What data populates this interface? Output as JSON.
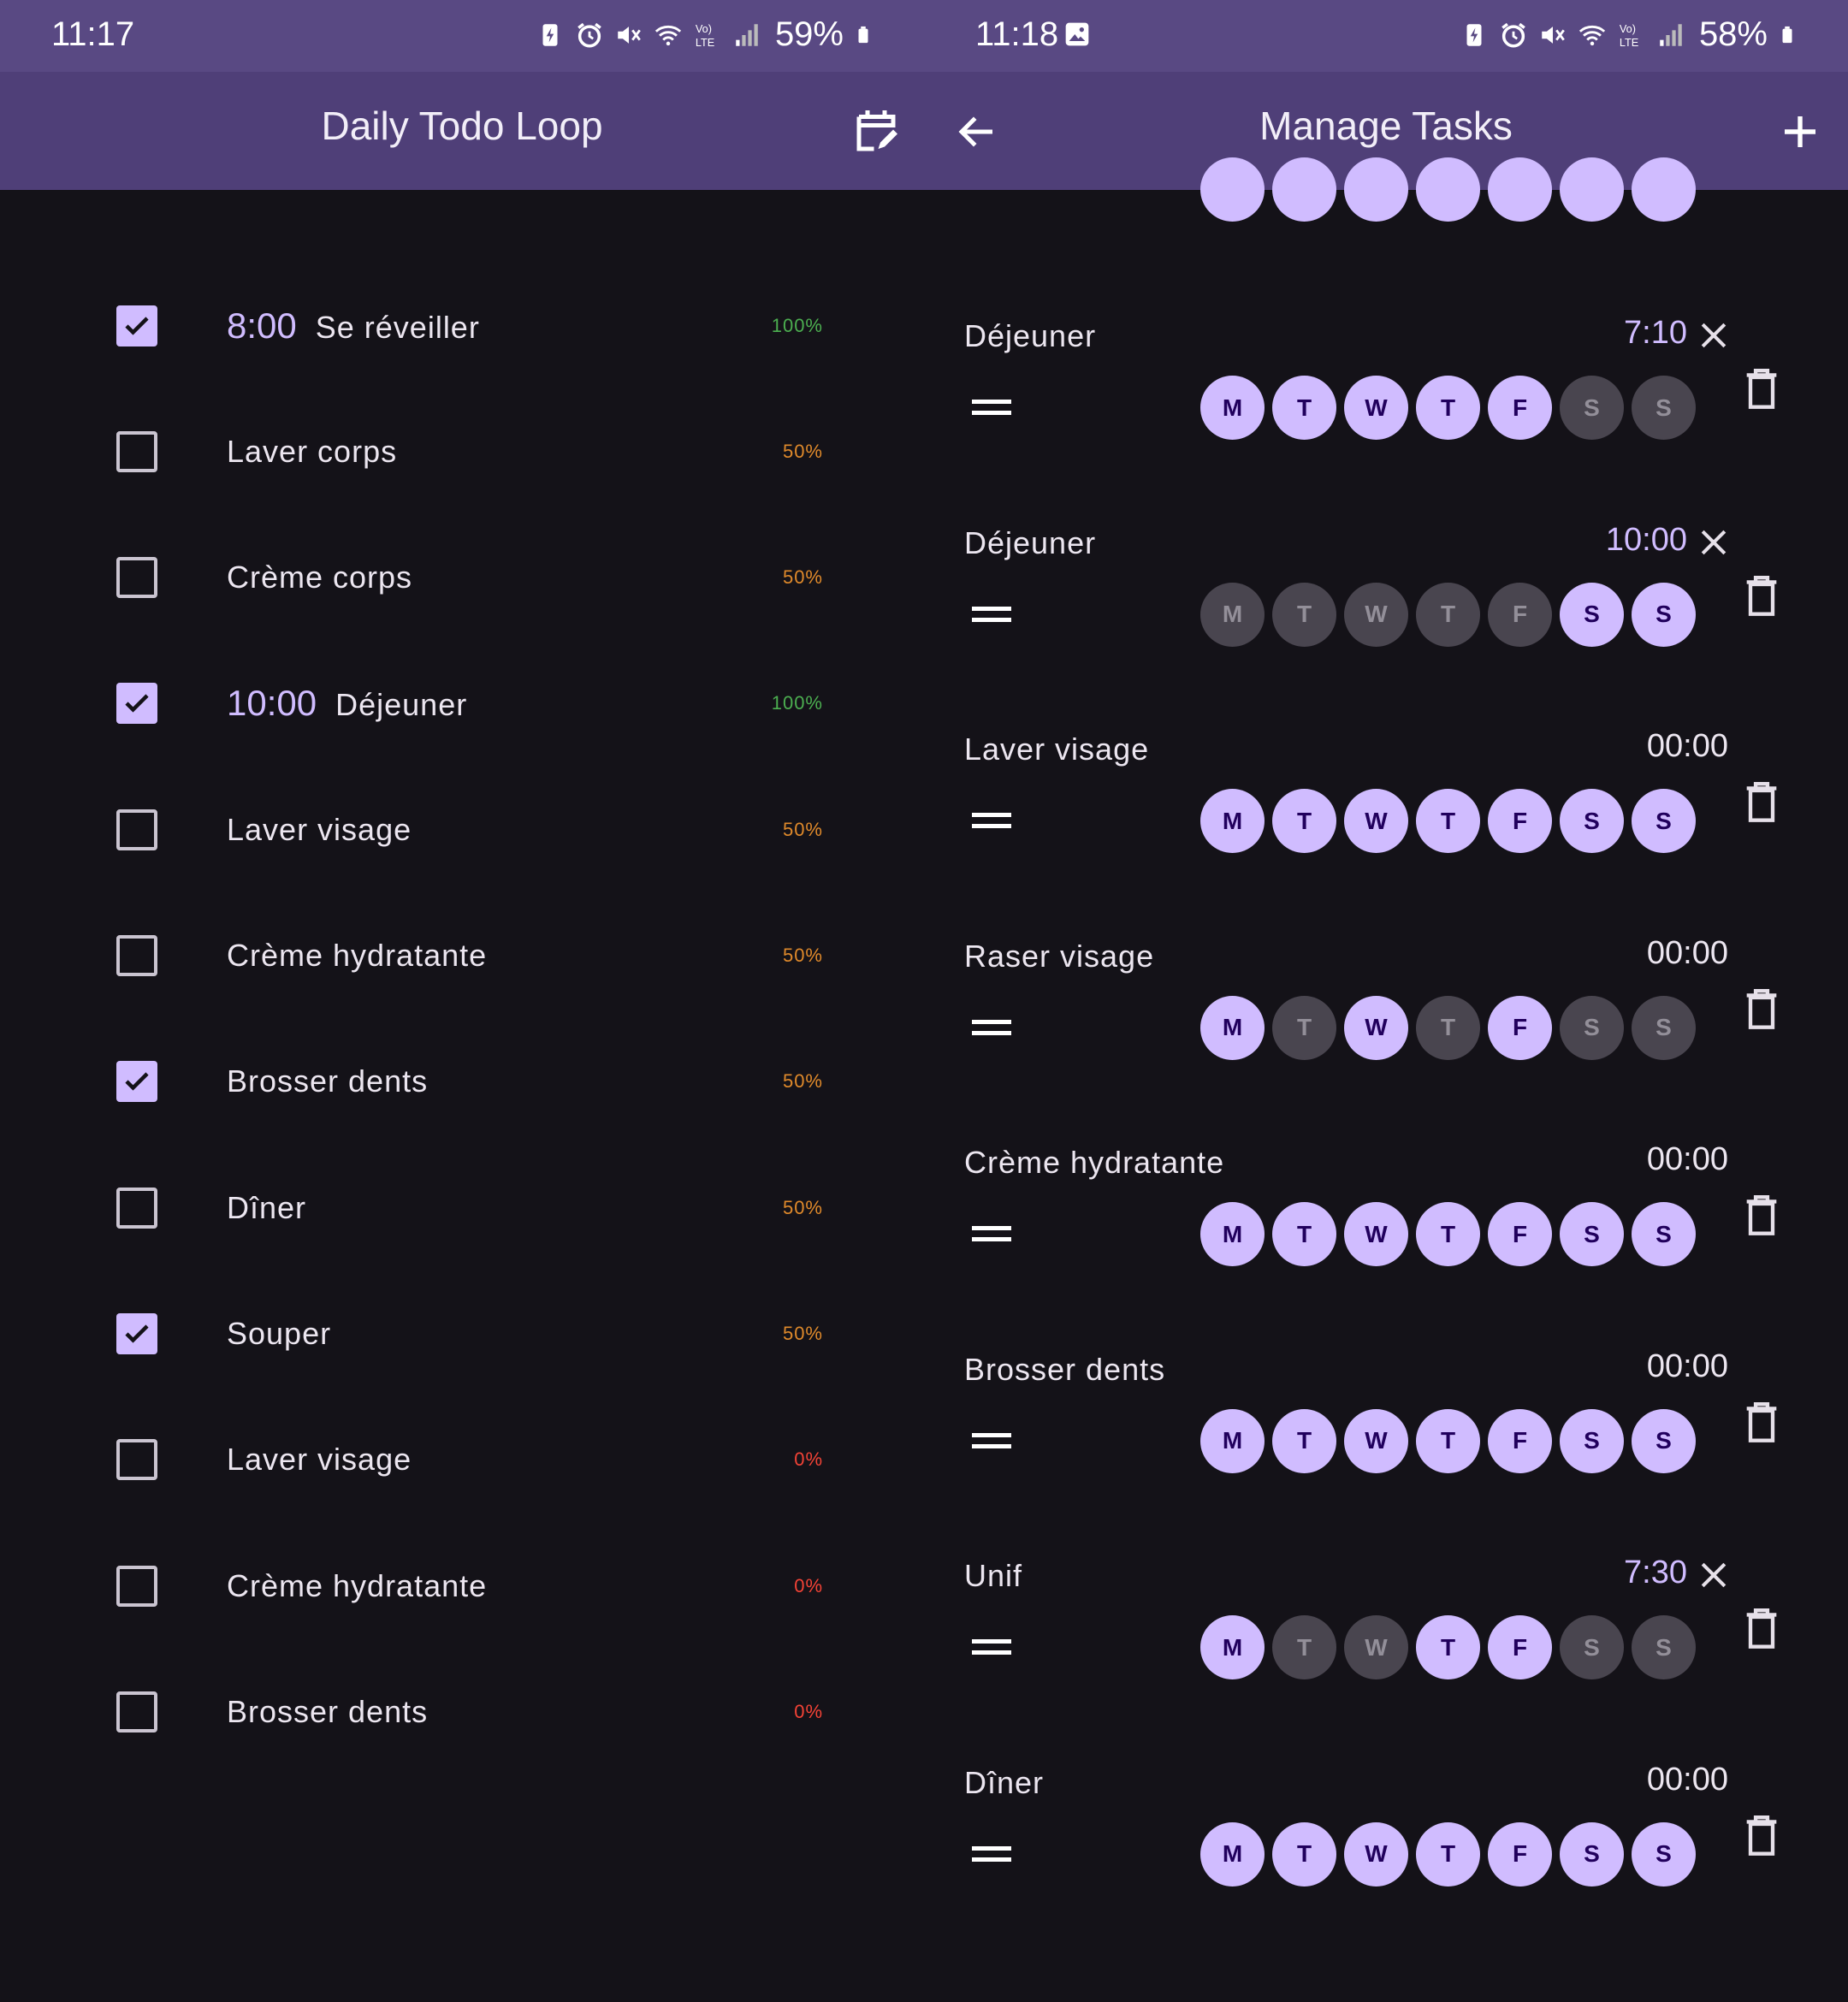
{
  "left": {
    "status": {
      "time": "11:17",
      "battery": "59%"
    },
    "title": "Daily Todo Loop",
    "todos": [
      {
        "time": "8:00",
        "name": "Se réveiller",
        "checked": true,
        "pct": "100%",
        "pct_color": "#4caf50"
      },
      {
        "time": "",
        "name": "Laver corps",
        "checked": false,
        "pct": "50%",
        "pct_color": "#e08a2b"
      },
      {
        "time": "",
        "name": "Crème corps",
        "checked": false,
        "pct": "50%",
        "pct_color": "#e08a2b"
      },
      {
        "time": "10:00",
        "name": "Déjeuner",
        "checked": true,
        "pct": "100%",
        "pct_color": "#4caf50"
      },
      {
        "time": "",
        "name": "Laver visage",
        "checked": false,
        "pct": "50%",
        "pct_color": "#e08a2b"
      },
      {
        "time": "",
        "name": "Crème hydratante",
        "checked": false,
        "pct": "50%",
        "pct_color": "#e08a2b"
      },
      {
        "time": "",
        "name": "Brosser dents",
        "checked": true,
        "pct": "50%",
        "pct_color": "#e08a2b"
      },
      {
        "time": "",
        "name": "Dîner",
        "checked": false,
        "pct": "50%",
        "pct_color": "#e08a2b"
      },
      {
        "time": "",
        "name": "Souper",
        "checked": true,
        "pct": "50%",
        "pct_color": "#e08a2b"
      },
      {
        "time": "",
        "name": "Laver visage",
        "checked": false,
        "pct": "0%",
        "pct_color": "#f44336"
      },
      {
        "time": "",
        "name": "Crème hydratante",
        "checked": false,
        "pct": "0%",
        "pct_color": "#f44336"
      },
      {
        "time": "",
        "name": "Brosser dents",
        "checked": false,
        "pct": "0%",
        "pct_color": "#f44336"
      }
    ]
  },
  "right": {
    "status": {
      "time": "11:18",
      "battery": "58%"
    },
    "title": "Manage Tasks",
    "day_letters": [
      "M",
      "T",
      "W",
      "T",
      "F",
      "S",
      "S"
    ],
    "tasks": [
      {
        "name": "Déjeuner",
        "time": "7:10",
        "time_set": true,
        "days": [
          1,
          1,
          1,
          1,
          1,
          0,
          0
        ]
      },
      {
        "name": "Déjeuner",
        "time": "10:00",
        "time_set": true,
        "days": [
          0,
          0,
          0,
          0,
          0,
          1,
          1
        ]
      },
      {
        "name": "Laver visage",
        "time": "00:00",
        "time_set": false,
        "days": [
          1,
          1,
          1,
          1,
          1,
          1,
          1
        ]
      },
      {
        "name": "Raser visage",
        "time": "00:00",
        "time_set": false,
        "days": [
          1,
          0,
          1,
          0,
          1,
          0,
          0
        ]
      },
      {
        "name": "Crème hydratante",
        "time": "00:00",
        "time_set": false,
        "days": [
          1,
          1,
          1,
          1,
          1,
          1,
          1
        ]
      },
      {
        "name": "Brosser dents",
        "time": "00:00",
        "time_set": false,
        "days": [
          1,
          1,
          1,
          1,
          1,
          1,
          1
        ]
      },
      {
        "name": "Unif",
        "time": "7:30",
        "time_set": true,
        "days": [
          1,
          0,
          0,
          1,
          1,
          0,
          0
        ]
      },
      {
        "name": "Dîner",
        "time": "00:00",
        "time_set": false,
        "days": [
          1,
          1,
          1,
          1,
          1,
          1,
          1
        ]
      }
    ]
  },
  "colors": {
    "accent": "#d0bcff",
    "appbar": "#4f3f78",
    "statusbar": "#594983",
    "background": "#141218"
  },
  "icons": {
    "edit_calendar": "edit-calendar-icon",
    "back": "back-arrow-icon",
    "add": "add-icon",
    "clear": "close-icon",
    "drag": "drag-handle-icon",
    "delete": "trash-icon"
  }
}
